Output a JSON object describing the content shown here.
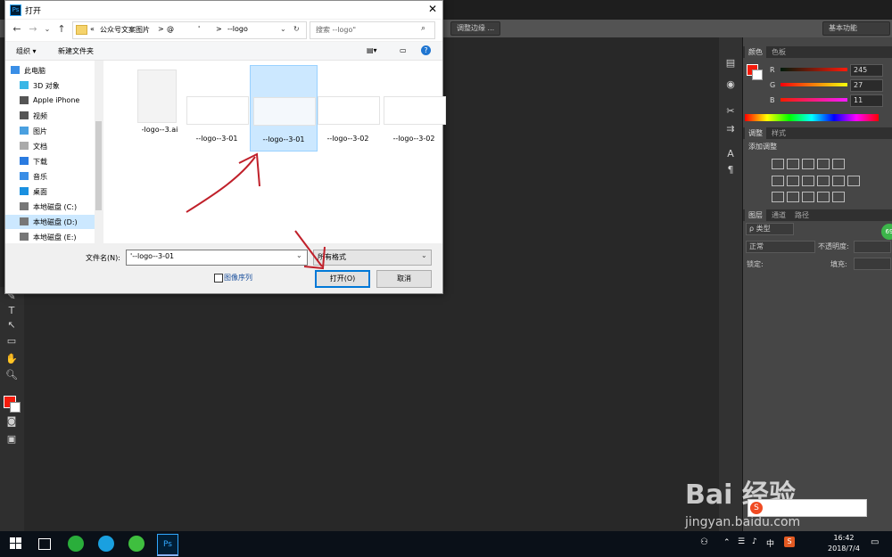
{
  "dialog": {
    "title": "打开",
    "address_crumbs": [
      "«",
      "公众号文案图片",
      ">",
      "@",
      "'",
      ">",
      "--logo"
    ],
    "search_placeholder": "搜索 --logo\"",
    "toolbar": {
      "organize": "组织 ▾",
      "new_folder": "新建文件夹"
    },
    "nav_items": [
      {
        "label": "此电脑",
        "icon": "computer-icon"
      },
      {
        "label": "3D 对象",
        "icon": "3d-objects-icon"
      },
      {
        "label": "Apple iPhone",
        "icon": "phone-icon"
      },
      {
        "label": "视频",
        "icon": "video-icon"
      },
      {
        "label": "图片",
        "icon": "pictures-icon"
      },
      {
        "label": "文档",
        "icon": "documents-icon"
      },
      {
        "label": "下载",
        "icon": "download-icon"
      },
      {
        "label": "音乐",
        "icon": "music-icon"
      },
      {
        "label": "桌面",
        "icon": "desktop-icon"
      },
      {
        "label": "本地磁盘 (C:)",
        "icon": "drive-icon"
      },
      {
        "label": "本地磁盘 (D:)",
        "icon": "drive-icon"
      },
      {
        "label": "本地磁盘 (E:)",
        "icon": "drive-icon"
      }
    ],
    "files": [
      {
        "name": "-logo--3.ai",
        "selected": false
      },
      {
        "name": "--logo--3-01",
        "selected": false
      },
      {
        "name": "--logo--3-01",
        "selected": true
      },
      {
        "name": "--logo--3-02",
        "selected": false
      },
      {
        "name": "--logo--3-02",
        "selected": false
      }
    ],
    "filename_label": "文件名(N):",
    "filename_value": "'--logo--3-01",
    "filetype_value": "所有格式",
    "image_sequence_label": "图像序列",
    "open_button": "打开(O)",
    "cancel_button": "取消"
  },
  "photoshop": {
    "options_pill": "调整边缘 ...",
    "workspace": "基本功能",
    "color_tabs": [
      "颜色",
      "色板"
    ],
    "rgb": [
      {
        "label": "R",
        "value": "245"
      },
      {
        "label": "G",
        "value": "27"
      },
      {
        "label": "B",
        "value": "11"
      }
    ],
    "adjust_tabs": [
      "调整",
      "样式"
    ],
    "add_adjustment": "添加调整",
    "layer_tabs": [
      "图层",
      "通道",
      "路径"
    ],
    "layer_filter": "ρ 类型",
    "blend_mode": "正常",
    "opacity_label": "不透明度:",
    "lock_label": "锁定:",
    "fill_label": "填充:",
    "badge": "69"
  },
  "taskbar": {
    "time": "16:42",
    "date": "2018/7/4",
    "ime": "中",
    "ime_sogou": "S"
  },
  "watermark": {
    "brand": "Bai 经验",
    "url": "jingyan.baidu.com"
  },
  "colors": {
    "foreground": "#f51b0b",
    "selection": "#cce8ff",
    "accent": "#0078d7"
  }
}
